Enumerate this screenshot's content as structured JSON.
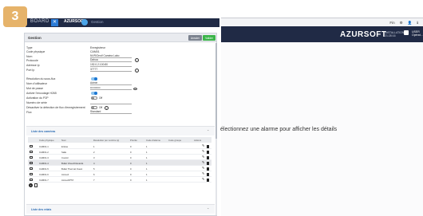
{
  "step": "3",
  "left_app": {
    "brand": "BOARD",
    "tab_close": "✕",
    "brand2": "AZURSOFT",
    "nav": "Gestion"
  },
  "right_app": {
    "toprow": [
      "Fin",
      "⚙",
      "👤",
      "ℹ"
    ],
    "logo": "AZURSOFT",
    "logo_sub": [
      "INSTALLATION",
      "21:28:16"
    ],
    "user": [
      "USER",
      "Opérat..."
    ],
    "message": "électionnez une alarme pour afficher les détails"
  },
  "dialog": {
    "title": "Gestion",
    "cancel_label": "Annuler",
    "ok_label": "Valider",
    "fields": [
      {
        "label": "Type",
        "value": "Enregistreur"
      },
      {
        "label": "Code physique",
        "value": "CAM01"
      },
      {
        "label": "Nom",
        "value": "NVR/Onvif Caméra Labo"
      },
      {
        "label": "Protocole",
        "value": "Dahua"
      },
      {
        "label": "Adresse ip",
        "value": "192.0.2.100:80"
      },
      {
        "label": "Port Ip",
        "value": "37777"
      }
    ],
    "fields2": [
      {
        "label": "Résolution du sous-flux",
        "kind": "toggle",
        "on": true,
        "value": ""
      },
      {
        "label": "Nom d'utilisateur",
        "kind": "text",
        "value": "Admin"
      },
      {
        "label": "Mot de passe",
        "kind": "password",
        "value": "•••••••••••"
      },
      {
        "label": "Activer l'encodage H265",
        "kind": "toggle",
        "on": true,
        "value": ""
      },
      {
        "label": "Activation du P2P",
        "kind": "toggle",
        "on": false,
        "value": "Off"
      },
      {
        "label": "Numéro de série",
        "kind": "text",
        "value": ""
      },
      {
        "label": "Désactiver la détection de flux d'enregistrement",
        "kind": "toggle",
        "on": false,
        "value": "Off"
      },
      {
        "label": "Flux",
        "kind": "text",
        "value": "Standard"
      }
    ],
    "section_cameras": "Liste des caméras",
    "columns": [
      "Code physique",
      "Nom",
      "Résolution (en nombre ip)",
      "Priorité",
      "Code d'alarme",
      "Code groupe",
      "Actions"
    ],
    "rows": [
      {
        "code": "CAM01-1",
        "name": "Entrée",
        "res": "1",
        "prio": "0",
        "alarm": "1",
        "group": "",
        "selected": false
      },
      {
        "code": "CAM01-2",
        "name": "Salle",
        "res": "2",
        "prio": "0",
        "alarm": "1",
        "group": "",
        "selected": false
      },
      {
        "code": "CAM01-3",
        "name": "Couloir",
        "res": "3",
        "prio": "0",
        "alarm": "1",
        "group": "",
        "selected": false
      },
      {
        "code": "CAM01-4",
        "name": "Bullet Visuel/Clavardé",
        "res": "4",
        "prio": "0",
        "alarm": "1",
        "group": "",
        "selected": true
      },
      {
        "code": "CAM01-5",
        "name": "Bullet Thermal Ouest",
        "res": "5",
        "prio": "0",
        "alarm": "1",
        "group": "",
        "selected": false
      },
      {
        "code": "CAM01-6",
        "name": "Accueil",
        "res": "6",
        "prio": "0",
        "alarm": "1",
        "group": "",
        "selected": false
      },
      {
        "code": "CAM01-7",
        "name": "Accueil/PTZ",
        "res": "7",
        "prio": "0",
        "alarm": "1",
        "group": "",
        "selected": false
      }
    ],
    "section_relays": "Liste des relais"
  }
}
